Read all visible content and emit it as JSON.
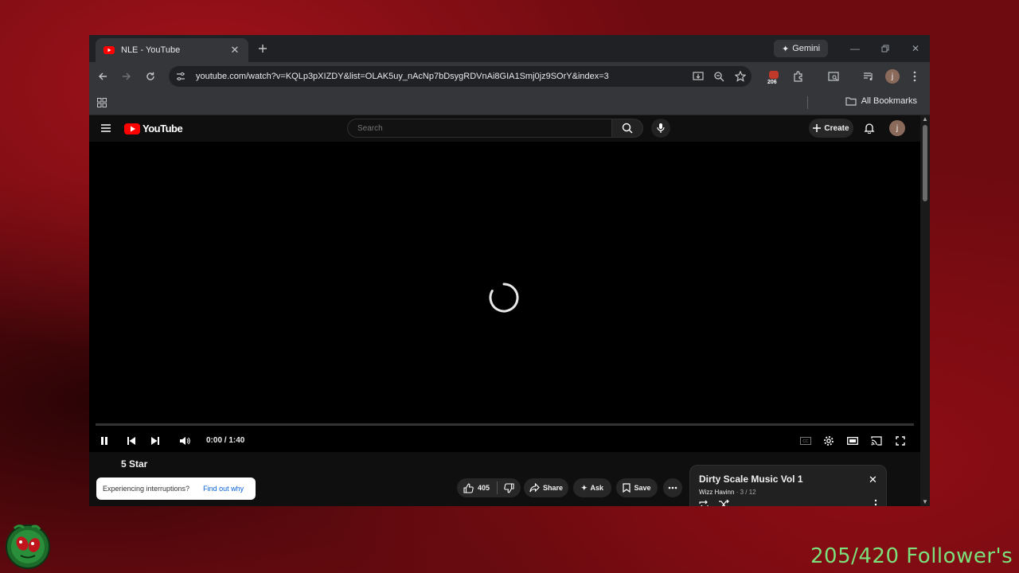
{
  "browser": {
    "tab_title": "NLE - YouTube",
    "gemini_label": "Gemini",
    "url": "youtube.com/watch?v=KQLp3pXIZDY&list=OLAK5uy_nAcNp7bDsygRDVnAi8GIA1Smj0jz9SOrY&index=3",
    "extension_badge": "206",
    "profile_initial": "j",
    "all_bookmarks": "All Bookmarks"
  },
  "youtube": {
    "logo_text": "YouTube",
    "search_placeholder": "Search",
    "create_label": "Create",
    "avatar_initial": "j",
    "player": {
      "time": "0:00 / 1:40",
      "state": "loading"
    },
    "video_title": "5 Star",
    "interruption": {
      "question": "Experiencing interruptions?",
      "link": "Find out why"
    },
    "actions": {
      "likes": "405",
      "share": "Share",
      "ask": "Ask",
      "save": "Save"
    },
    "playlist": {
      "title": "Dirty Scale Music Vol 1",
      "author": "Wizz Havinn",
      "position": "3 / 12"
    }
  },
  "overlay": {
    "followers": "205/420 Follower's"
  },
  "colors": {
    "youtube_red": "#ff0000",
    "followers_text": "#7be07b",
    "link_blue": "#065fd4"
  }
}
